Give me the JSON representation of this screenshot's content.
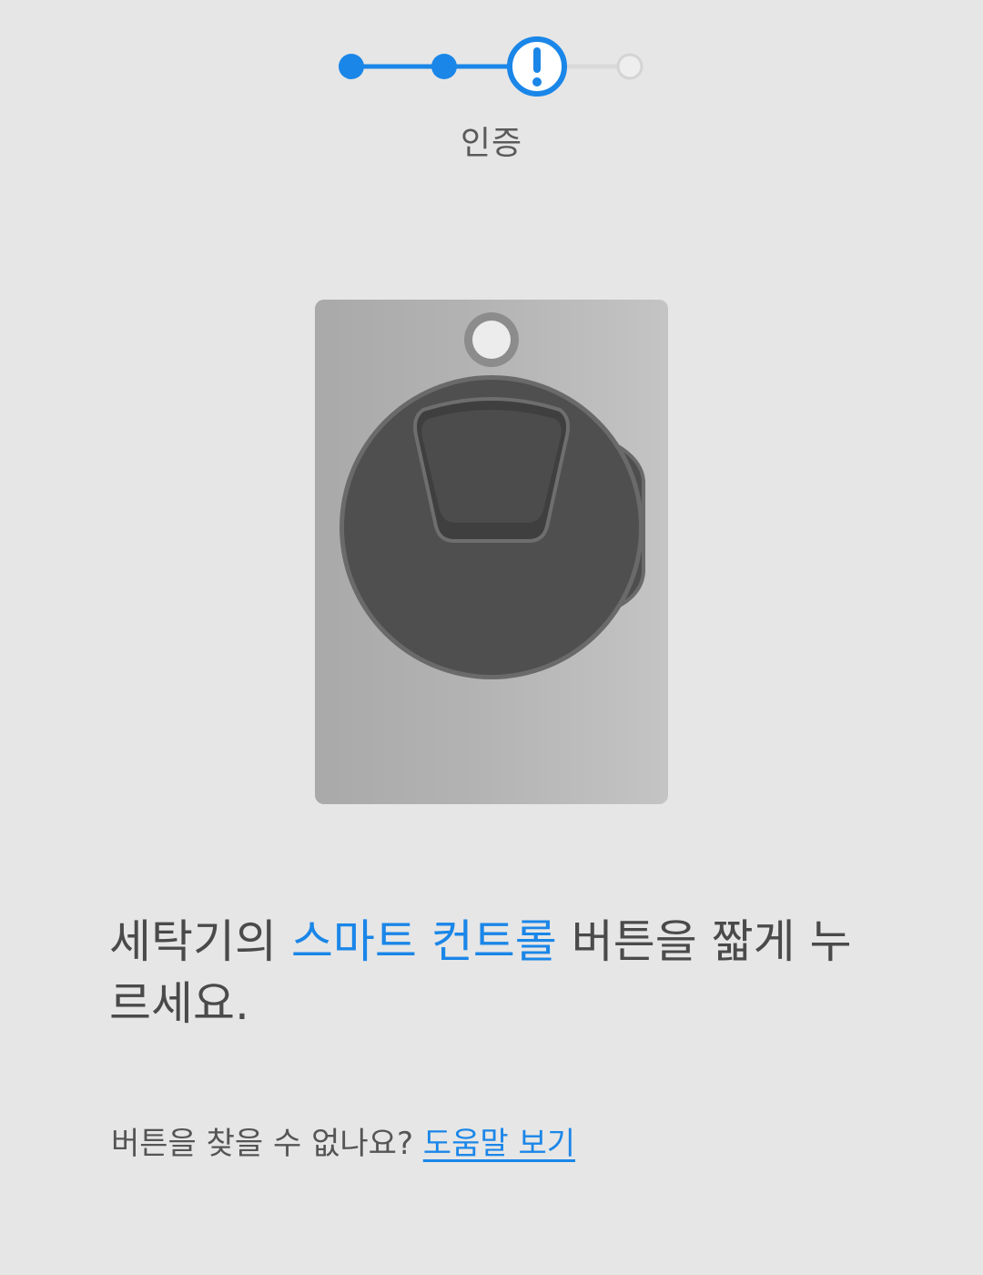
{
  "stepper": {
    "steps": [
      {
        "state": "done"
      },
      {
        "state": "done"
      },
      {
        "state": "current-warning"
      },
      {
        "state": "pending"
      }
    ],
    "current_label": "인증",
    "colors": {
      "active": "#1a86e8",
      "pending": "#d9d9d9"
    }
  },
  "illustration": {
    "subject": "front-load washing machine",
    "icon": "washing-machine-icon"
  },
  "instruction": {
    "prefix": "세탁기의 ",
    "highlight": "스마트 컨트롤",
    "suffix": " 버튼을 짧게 누르세요."
  },
  "help": {
    "question": "버튼을 찾을 수 없나요? ",
    "link_label": "도움말 보기"
  },
  "colors": {
    "background": "#e6e6e6",
    "accent": "#1a86e8",
    "text": "#4a4a4a"
  }
}
